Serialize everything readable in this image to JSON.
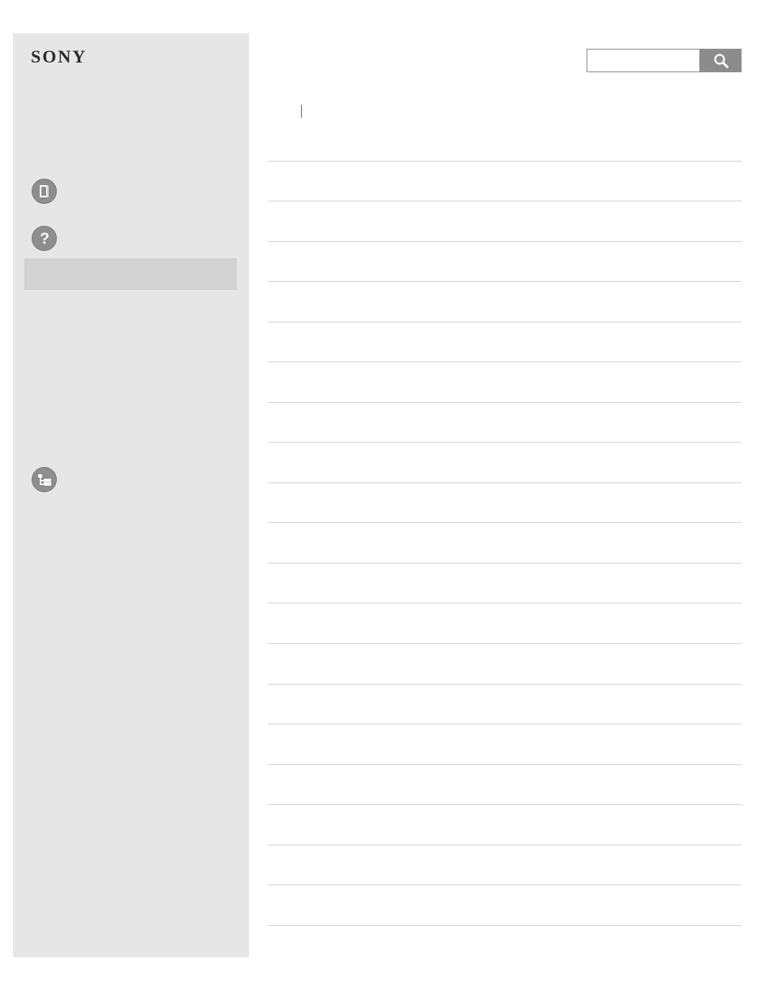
{
  "header": {
    "brand": "SONY"
  },
  "sidebar": {
    "icons": [
      "manual-icon",
      "help-question-icon",
      "site-map-icon"
    ]
  },
  "search": {
    "placeholder": "",
    "button_icon": "search-icon"
  },
  "colors": {
    "sidebar_bg": "#e6e6e6",
    "active_item_bg": "#d2d2d2",
    "icon_circle": "#8e8e8e",
    "search_button": "#8c8c8c",
    "row_divider": "#d4d4d4"
  }
}
